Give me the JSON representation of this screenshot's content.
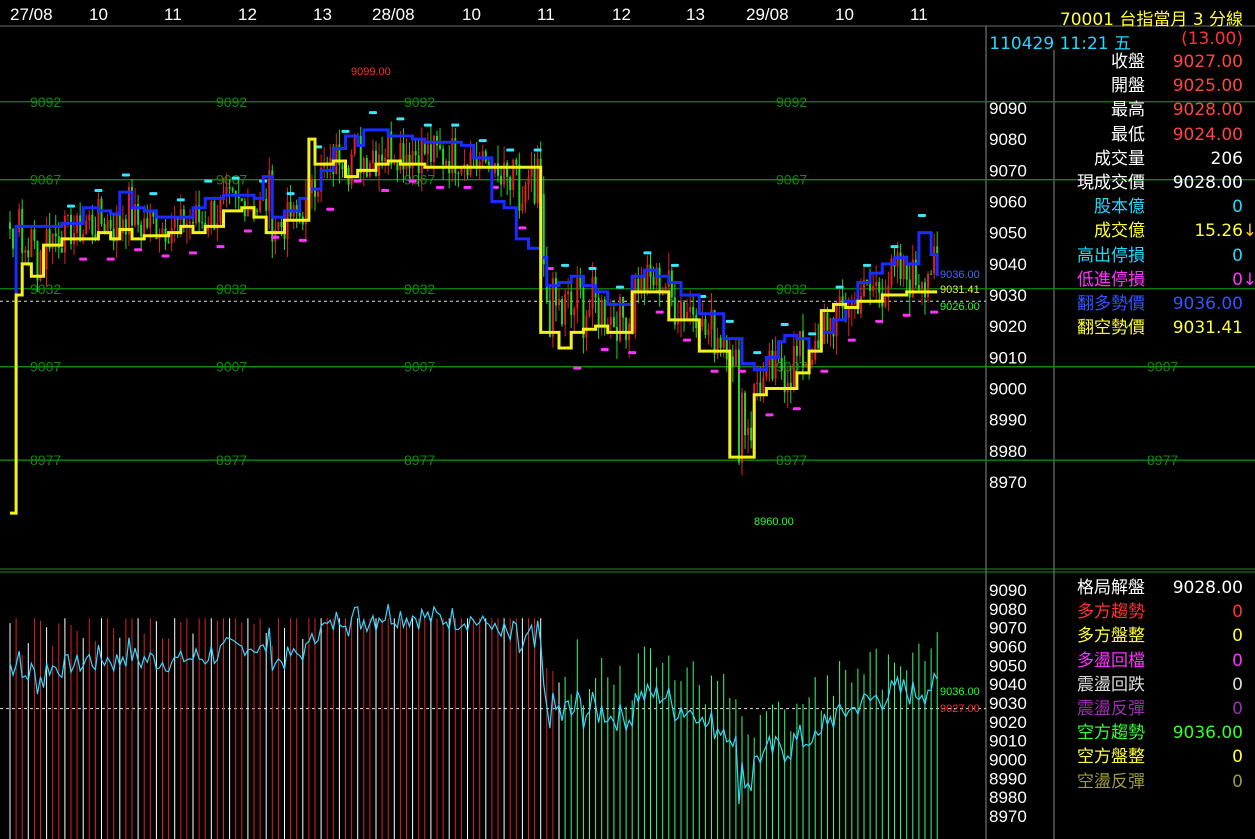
{
  "header": {
    "symbol_line": "70001 台指當月 3 分線",
    "datetime": "110429 11:21 五",
    "change": "(13.00)"
  },
  "time_axis": {
    "labels": [
      "27/08",
      "10",
      "11",
      "12",
      "13",
      "28/08",
      "10",
      "11",
      "12",
      "13",
      "29/08",
      "10",
      "11"
    ]
  },
  "price_panel": {
    "ylim": [
      8960,
      9100
    ],
    "y_ticks": [
      9090,
      9080,
      9070,
      9060,
      9050,
      9040,
      9030,
      9020,
      9010,
      9000,
      8990,
      8980,
      8970
    ],
    "grid_levels": [
      {
        "value": 9092,
        "label": "9092",
        "color": "#0a8c0a"
      },
      {
        "value": 9067,
        "label": "9067",
        "color": "#0a8c0a"
      },
      {
        "value": 9032,
        "label": "9032",
        "color": "#0a8c0a"
      },
      {
        "value": 9007,
        "label": "9007",
        "color": "#0a8c0a"
      },
      {
        "value": 8977,
        "label": "8977",
        "color": "#0a8c0a"
      }
    ],
    "annotations": [
      {
        "text": "9099.00",
        "color": "#ff2a2a"
      },
      {
        "text": "8960.00",
        "color": "#22ff22"
      },
      {
        "text": "9036.00",
        "color": "#3f6bff"
      },
      {
        "text": "9031.41",
        "color": "#e8e84a"
      },
      {
        "text": "9026.00",
        "color": "#22ff22"
      }
    ],
    "current_price": 9028
  },
  "indicator_panel": {
    "y_ticks": [
      9090,
      9080,
      9070,
      9060,
      9050,
      9040,
      9030,
      9020,
      9010,
      9000,
      8990,
      8980,
      8970
    ],
    "annotations": [
      {
        "text": "9036.00",
        "color": "#22ff22"
      },
      {
        "text": "9027.00",
        "color": "#ff2a2a"
      }
    ]
  },
  "chart_data": {
    "type": "line",
    "series": [
      {
        "name": "翻多勢價",
        "color": "#1a2cff",
        "x": [
          0,
          2,
          7,
          17,
          24,
          29,
          33,
          36,
          40,
          44,
          48,
          52,
          56,
          60,
          64,
          70,
          76,
          80,
          83,
          86,
          90,
          95,
          98,
          102,
          106,
          110,
          114,
          116,
          120,
          124,
          128,
          132,
          136,
          140,
          144,
          148,
          152,
          156,
          158,
          162,
          166,
          170,
          174,
          176,
          180,
          184,
          188,
          192,
          196,
          200,
          204,
          208,
          212,
          216,
          220,
          224,
          226,
          230,
          234,
          236,
          240,
          244,
          248,
          252,
          254,
          258,
          262,
          266,
          270,
          274,
          278,
          282,
          286,
          290,
          294,
          298,
          302,
          304
        ],
        "y": [
          8960,
          9052,
          9052,
          9053,
          9058,
          9057,
          9056,
          9063,
          9058,
          9057,
          9055,
          9055,
          9055,
          9058,
          9061,
          9062,
          9062,
          9061,
          9068,
          9055,
          9057,
          9061,
          9064,
          9070,
          9077,
          9081,
          9078,
          9083,
          9083,
          9081,
          9081,
          9080,
          9079,
          9079,
          9079,
          9078,
          9074,
          9074,
          9060,
          9058,
          9048,
          9045,
          9042,
          9033,
          9034,
          9036,
          9033,
          9031,
          9027,
          9027,
          9036,
          9038,
          9036,
          9034,
          9030,
          9030,
          9024,
          9024,
          9016,
          9016,
          9008,
          9006,
          9010,
          9015,
          9017,
          9016,
          9012,
          9018,
          9022,
          9028,
          9034,
          9037,
          9040,
          9042,
          9040,
          9050,
          9043,
          9036
        ]
      },
      {
        "name": "翻空勢價",
        "color": "#f2f21a",
        "x": [
          0,
          2,
          4,
          7,
          11,
          17,
          24,
          29,
          33,
          36,
          40,
          44,
          52,
          56,
          60,
          64,
          70,
          76,
          80,
          84,
          86,
          90,
          98,
          100,
          102,
          106,
          110,
          114,
          120,
          124,
          128,
          132,
          136,
          140,
          144,
          148,
          152,
          156,
          158,
          162,
          166,
          170,
          174,
          176,
          180,
          184,
          188,
          192,
          196,
          200,
          204,
          208,
          212,
          216,
          220,
          224,
          226,
          230,
          234,
          236,
          240,
          244,
          248,
          252,
          254,
          258,
          262,
          266,
          270,
          274,
          278,
          282,
          286,
          290,
          294,
          298,
          302,
          304
        ],
        "y": [
          8960,
          9030,
          9040,
          9036,
          9046,
          9048,
          9048,
          9050,
          9048,
          9051,
          9048,
          9049,
          9050,
          9052,
          9050,
          9052,
          9057,
          9058,
          9055,
          9050,
          9050,
          9054,
          9080,
          9072,
          9072,
          9073,
          9068,
          9070,
          9072,
          9073,
          9072,
          9072,
          9071,
          9071,
          9071,
          9071,
          9071,
          9071,
          9071,
          9071,
          9071,
          9071,
          9018,
          9018,
          9013,
          9018,
          9019,
          9020,
          9018,
          9018,
          9031,
          9031,
          9031,
          9022,
          9022,
          9022,
          9012,
          9012,
          9012,
          8978,
          8978,
          8998,
          9000,
          9000,
          9000,
          9005,
          9012,
          9025,
          9027,
          9026,
          9028,
          9028,
          9030,
          9030,
          9031,
          9031,
          9031,
          9031
        ]
      }
    ],
    "xlabel": "",
    "ylabel": "",
    "ylim": [
      8960,
      9100
    ]
  },
  "info_panel": {
    "items": [
      {
        "label": "收盤",
        "value": "9027.00",
        "label_color": "#ffffff",
        "value_color": "#ff4444"
      },
      {
        "label": "開盤",
        "value": "9025.00",
        "label_color": "#ffffff",
        "value_color": "#ff4444"
      },
      {
        "label": "最高",
        "value": "9028.00",
        "label_color": "#ffffff",
        "value_color": "#ff4444"
      },
      {
        "label": "最低",
        "value": "9024.00",
        "label_color": "#ffffff",
        "value_color": "#ff4444"
      },
      {
        "label": "成交量",
        "value": "206",
        "label_color": "#ffffff",
        "value_color": "#ffffff"
      },
      {
        "label": "現成交價",
        "value": "9028.00",
        "label_color": "#ffffff",
        "value_color": "#ffffff"
      },
      {
        "label": "股本億",
        "value": "0",
        "label_color": "#22d8ff",
        "value_color": "#22d8ff"
      },
      {
        "label": "成交億",
        "value": "15.26",
        "label_color": "#ffff33",
        "value_color": "#ffff33",
        "arrow": "↓",
        "arrow_color": "#ffcc00"
      },
      {
        "label": "高出停損",
        "value": "0",
        "label_color": "#22d8ff",
        "value_color": "#22d8ff"
      },
      {
        "label": "低進停損",
        "value": "0",
        "label_color": "#ff33ff",
        "value_color": "#ff33ff",
        "arrow": "↓",
        "arrow_color": "#ff33ff"
      },
      {
        "label": "翻多勢價",
        "value": "9036.00",
        "label_color": "#3355ff",
        "value_color": "#3355ff"
      },
      {
        "label": "翻空勢價",
        "value": "9031.41",
        "label_color": "#ffff33",
        "value_color": "#ffff33"
      }
    ]
  },
  "pattern_panel": {
    "items": [
      {
        "label": "格局解盤",
        "value": "9028.00",
        "label_color": "#ffffff",
        "value_color": "#ffffff"
      },
      {
        "label": "多方趨勢",
        "value": "0",
        "label_color": "#ff3333",
        "value_color": "#ff3333"
      },
      {
        "label": "多方盤整",
        "value": "0",
        "label_color": "#ffff33",
        "value_color": "#ffff33"
      },
      {
        "label": "多盪回檔",
        "value": "0",
        "label_color": "#ff33ff",
        "value_color": "#ff33ff"
      },
      {
        "label": "震盪回跌",
        "value": "0",
        "label_color": "#dddddd",
        "value_color": "#dddddd"
      },
      {
        "label": "震盪反彈",
        "value": "0",
        "label_color": "#9a2fb0",
        "value_color": "#9a2fb0"
      },
      {
        "label": "空方趨勢",
        "value": "9036.00",
        "label_color": "#33ff33",
        "value_color": "#33ff33"
      },
      {
        "label": "空方盤整",
        "value": "0",
        "label_color": "#ffff33",
        "value_color": "#ffff33"
      },
      {
        "label": "空盪反彈",
        "value": "0",
        "label_color": "#9a9a3a",
        "value_color": "#9a9a3a"
      }
    ]
  }
}
